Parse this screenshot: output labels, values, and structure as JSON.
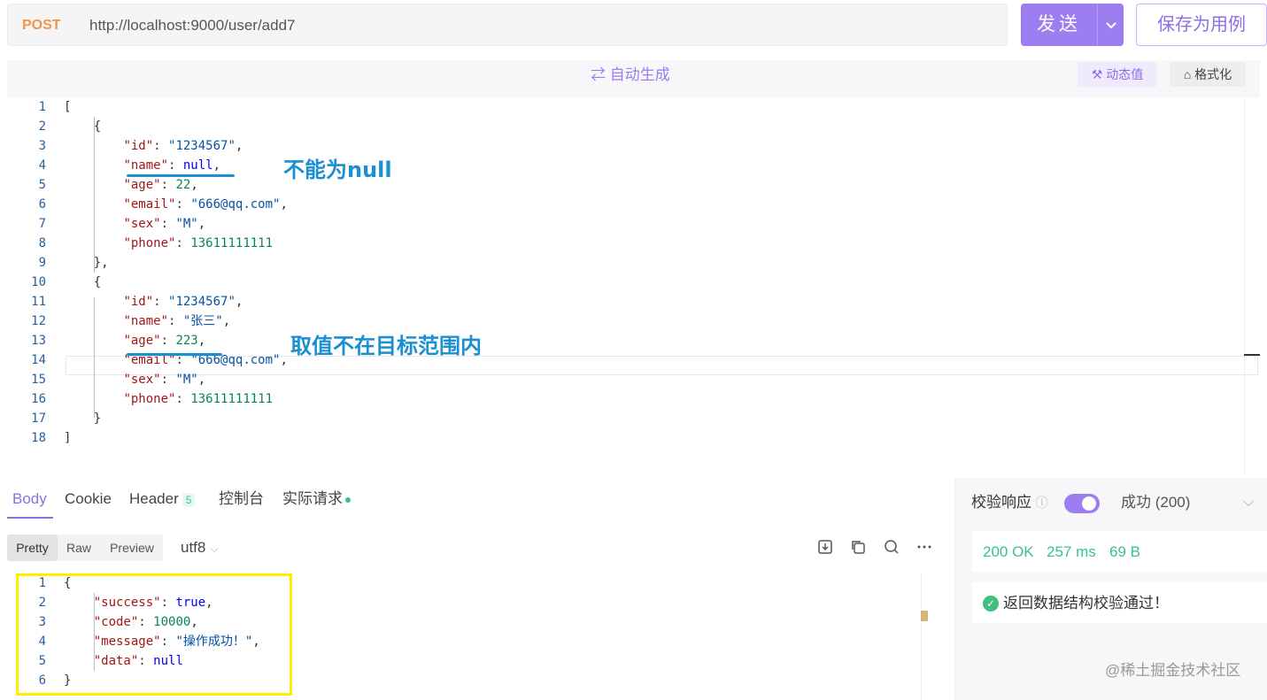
{
  "request": {
    "method": "POST",
    "url": "http://localhost:9000/user/add7",
    "send_label": "发送",
    "save_label": "保存为用例"
  },
  "editor_toolbar": {
    "auto_generate": "自动生成",
    "dynamic_value": "动态值",
    "format": "格式化"
  },
  "request_body": {
    "line_numbers": [
      "1",
      "2",
      "3",
      "4",
      "5",
      "6",
      "7",
      "8",
      "9",
      "10",
      "11",
      "12",
      "13",
      "14",
      "15",
      "16",
      "17",
      "18"
    ],
    "lines": [
      "[",
      "    {",
      "        \"id\": \"1234567\",",
      "        \"name\": null,",
      "        \"age\": 22,",
      "        \"email\": \"666@qq.com\",",
      "        \"sex\": \"M\",",
      "        \"phone\": 13611111111",
      "    },",
      "    {",
      "        \"id\": \"1234567\",",
      "        \"name\": \"张三\",",
      "        \"age\": 223,",
      "        \"email\": \"666@qq.com\",",
      "        \"sex\": \"M\",",
      "        \"phone\": 13611111111",
      "    }",
      "]"
    ]
  },
  "annotations": {
    "note1": "不能为null",
    "note2": "取值不在目标范围内"
  },
  "response_tabs": {
    "body": "Body",
    "cookie": "Cookie",
    "header": "Header",
    "header_count": "5",
    "console": "控制台",
    "actual_request": "实际请求"
  },
  "view_modes": {
    "pretty": "Pretty",
    "raw": "Raw",
    "preview": "Preview",
    "encoding": "utf8"
  },
  "response_body": {
    "line_numbers": [
      "1",
      "2",
      "3",
      "4",
      "5",
      "6"
    ],
    "lines": [
      "{",
      "    \"success\": true,",
      "    \"code\": 10000,",
      "    \"message\": \"操作成功！\",",
      "    \"data\": null",
      "}"
    ]
  },
  "verify_panel": {
    "label": "校验响应",
    "result": "成功 (200)",
    "status": "200 OK",
    "time": "257 ms",
    "size": "69 B",
    "check_message": "返回数据结构校验通过！"
  },
  "watermark": "@稀土掘金技术社区",
  "colors": {
    "accent": "#9c7ef0",
    "method": "#f0954a",
    "annotation": "#1a8fd1",
    "success": "#3cc18a",
    "highlight_box": "#ffee00"
  }
}
